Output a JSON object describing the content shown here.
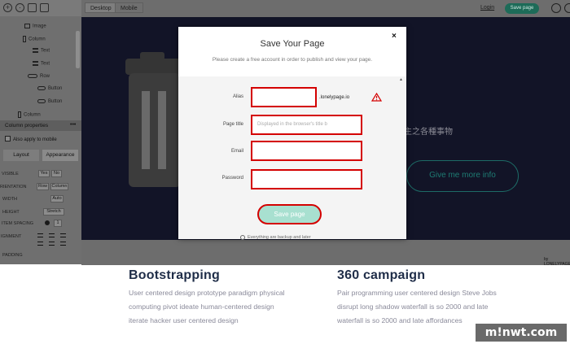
{
  "topbar": {
    "tabs": [
      {
        "label": "Desktop"
      },
      {
        "label": "Mobile"
      }
    ],
    "login": "Login",
    "save_label": "Save page"
  },
  "sidebar": {
    "tree": [
      {
        "label": "Image",
        "icon": "image-icon"
      },
      {
        "label": "Column",
        "icon": "column-icon"
      },
      {
        "label": "Text",
        "icon": "text-icon"
      },
      {
        "label": "Text",
        "icon": "text-icon"
      },
      {
        "label": "Row",
        "icon": "row-icon"
      },
      {
        "label": "Button",
        "icon": "button-icon"
      },
      {
        "label": "Button",
        "icon": "button-icon"
      },
      {
        "label": "Column",
        "icon": "column-icon"
      }
    ],
    "section_title": "Column properties",
    "apply_mobile": "Also apply to mobile",
    "tabs": [
      {
        "label": "Layout"
      },
      {
        "label": "Appearance"
      }
    ],
    "props": {
      "visible": "VISIBLE",
      "visible_yes": "Yes",
      "visible_no": "No",
      "orientation": "RIENTATION",
      "orientation_row": "Row",
      "orientation_column": "Column",
      "width": "WIDTH",
      "width_value": "Auto",
      "height": "HEIGHT",
      "height_value": "Stretch",
      "item_spacing": "ITEM SPACING",
      "item_spacing_value": "1",
      "alignment": "IGNMENT",
      "padding": "PADDING"
    }
  },
  "canvas": {
    "right_text": "主之各種事物",
    "cta_label": "Give me more info",
    "byline": "by LONELYPAGE"
  },
  "modal": {
    "title": "Save Your Page",
    "subtitle": "Please create a free account in order to publish and view your page.",
    "close": "×",
    "fields": {
      "alias_label": "Alias",
      "alias_suffix": ".lonelypage.io",
      "page_title_label": "Page title",
      "page_title_placeholder": "Displayed in the browser's title b",
      "email_label": "Email",
      "password_label": "Password"
    },
    "save_button": "Save page",
    "terms": "Everything are backup and later"
  },
  "sections": [
    {
      "title": "Bootstrapping",
      "lines": [
        "User centered design prototype paradigm physical",
        "computing pivot ideate human-centered design",
        "iterate hacker user centered design"
      ]
    },
    {
      "title": "360 campaign",
      "lines": [
        "Pair programming user centered design Steve Jobs",
        "disrupt long shadow waterfall is so 2000 and late",
        "waterfall is so 2000 and late affordances"
      ]
    }
  ],
  "watermark": "m!nwt.com",
  "colors": {
    "canvas_bg": "#121427",
    "accent": "#1d6b58",
    "highlight": "#d40000",
    "save_button_fill": "#a8e0d0"
  }
}
